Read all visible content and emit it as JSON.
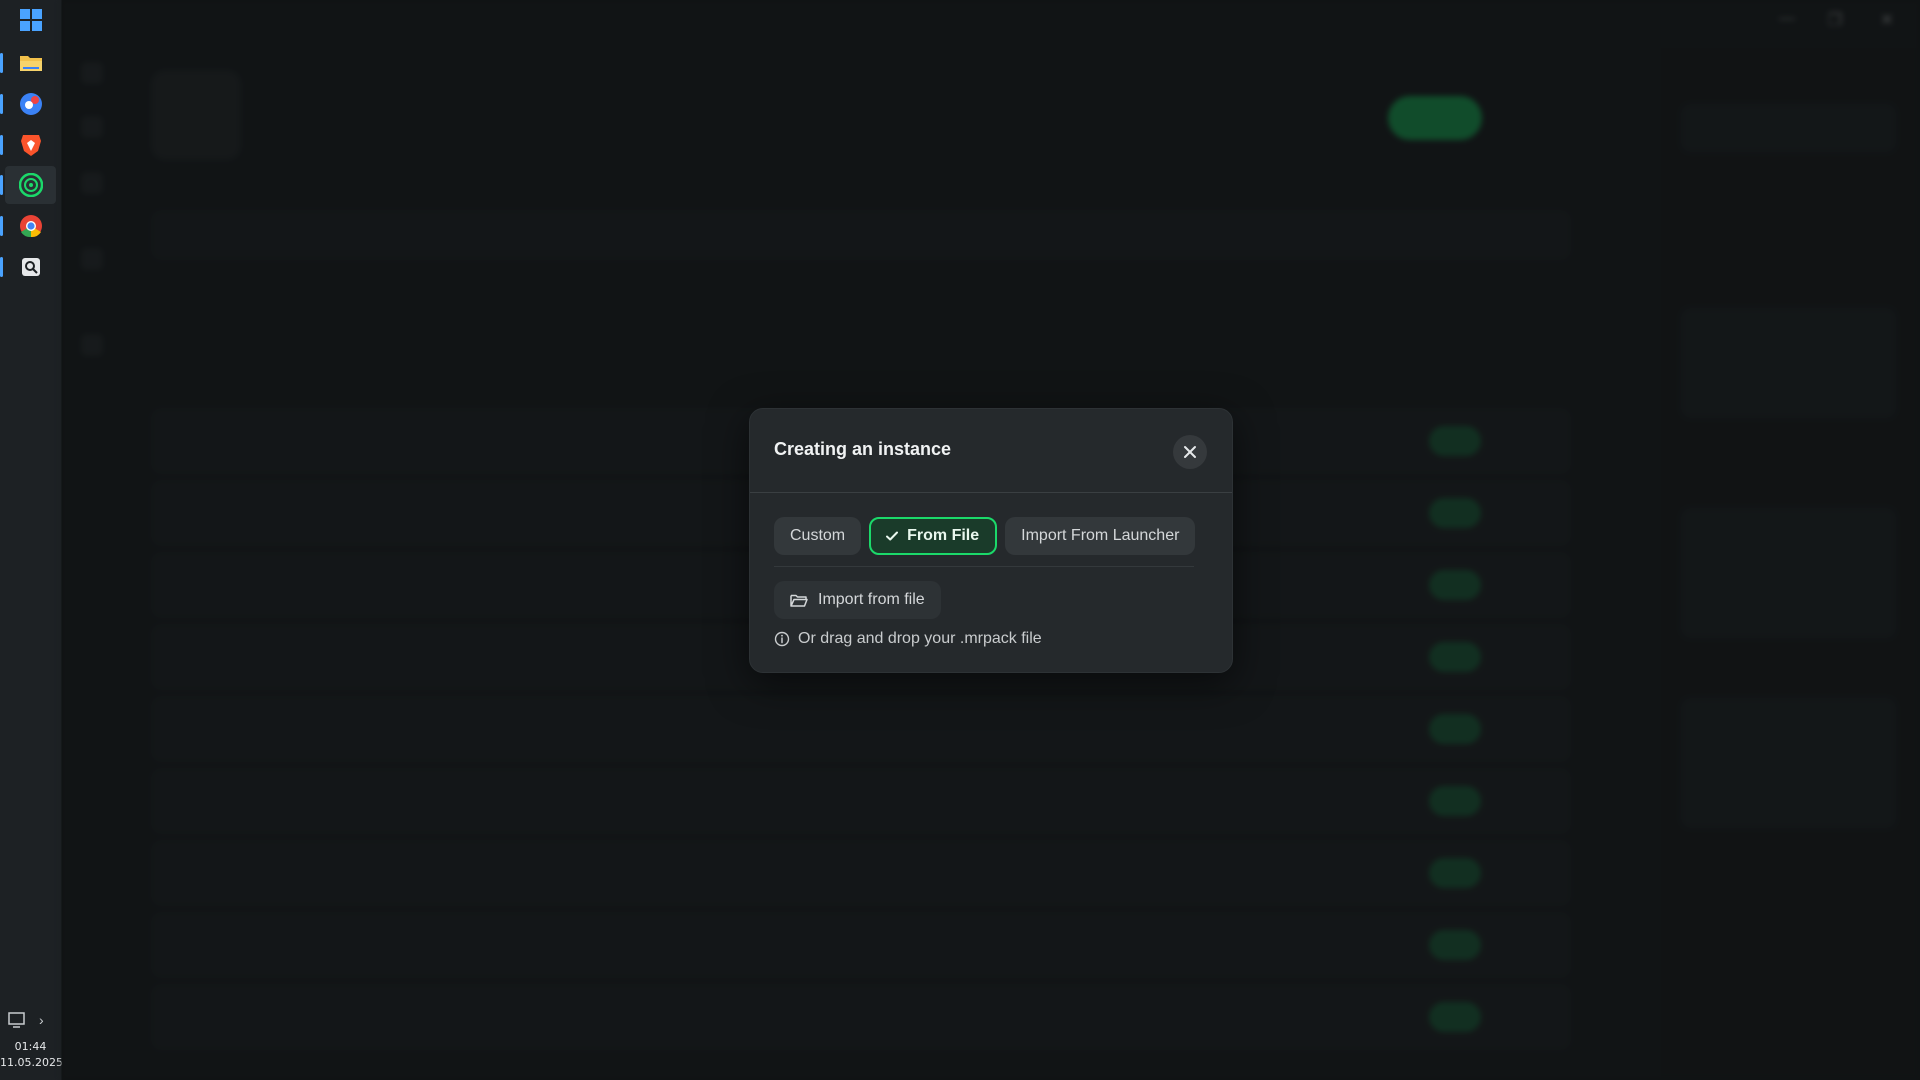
{
  "taskbar": {
    "apps": [
      {
        "name": "windows-start-icon",
        "color": "#4aa3ff"
      },
      {
        "name": "file-explorer-icon",
        "color": "#f2c14b"
      },
      {
        "name": "cloud-app-icon",
        "color": "#3b82f6"
      },
      {
        "name": "brave-browser-icon",
        "color": "#fb542b"
      },
      {
        "name": "modrinth-app-icon",
        "color": "#1bd96a"
      },
      {
        "name": "chrome-browser-icon",
        "color": "#ea4335"
      },
      {
        "name": "search-app-icon",
        "color": "#e6e8ea"
      }
    ],
    "time": "01:44",
    "date": "11.05.2025"
  },
  "window": {
    "minimize_glyph": "—",
    "maximize_glyph": "❐",
    "close_glyph": "✕"
  },
  "modal": {
    "title": "Creating an instance",
    "tabs": [
      {
        "label": "Custom",
        "selected": false
      },
      {
        "label": "From File",
        "selected": true
      },
      {
        "label": "Import From Launcher",
        "selected": false
      }
    ],
    "import_button_label": "Import from file",
    "hint_text": "Or drag and drop your .mrpack file"
  },
  "colors": {
    "accent": "#1bd96a",
    "modal_bg": "#25292c"
  }
}
